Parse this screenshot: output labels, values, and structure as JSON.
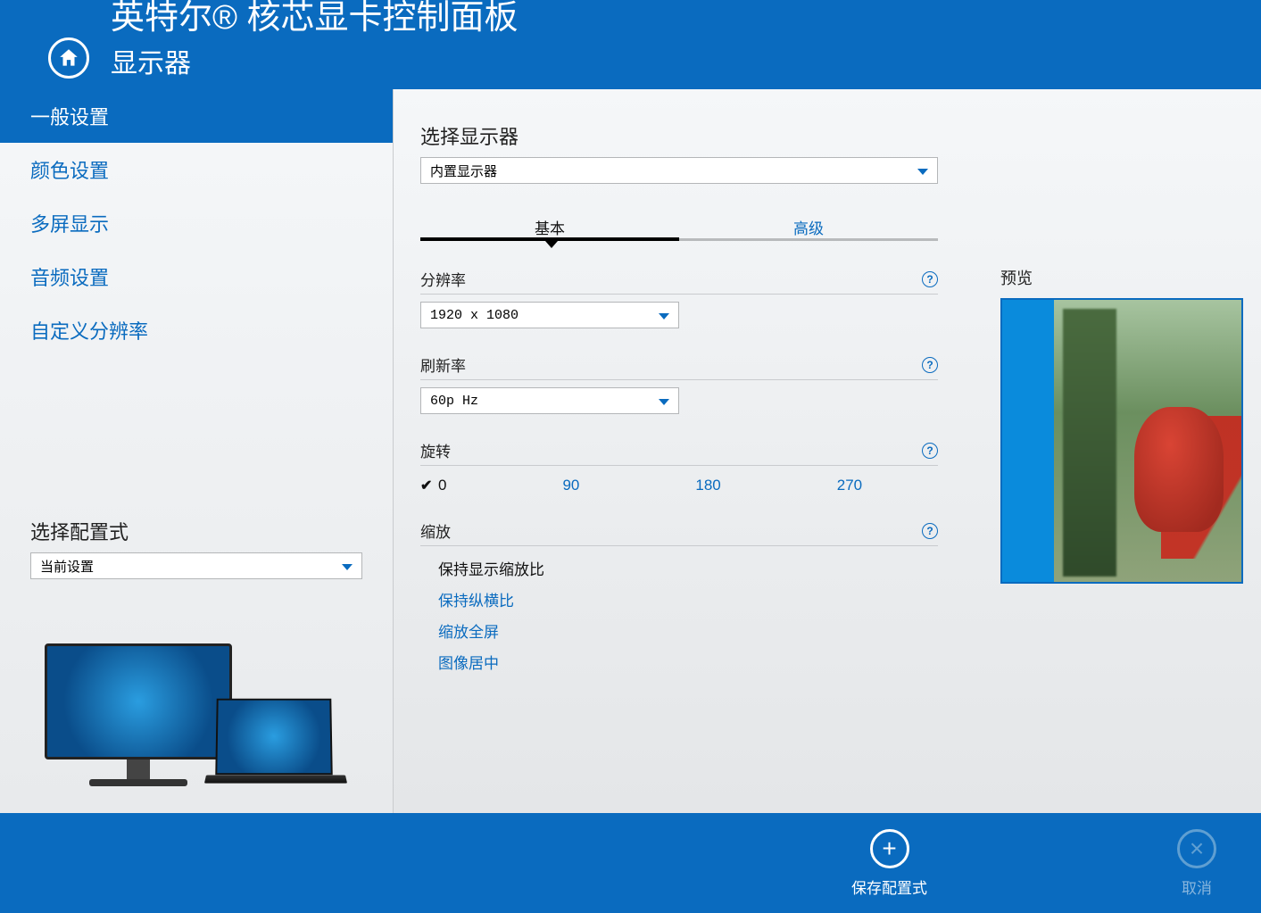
{
  "header": {
    "app_title": "英特尔® 核芯显卡控制面板",
    "page_title": "显示器"
  },
  "sidebar": {
    "items": [
      {
        "label": "一般设置",
        "active": true
      },
      {
        "label": "颜色设置",
        "active": false
      },
      {
        "label": "多屏显示",
        "active": false
      },
      {
        "label": "音频设置",
        "active": false
      },
      {
        "label": "自定义分辨率",
        "active": false
      }
    ],
    "profile_label": "选择配置式",
    "profile_value": "当前设置"
  },
  "main": {
    "select_display_label": "选择显示器",
    "select_display_value": "内置显示器",
    "tabs": {
      "basic": "基本",
      "advanced": "高级"
    },
    "resolution": {
      "label": "分辨率",
      "value": "1920 x 1080"
    },
    "refresh": {
      "label": "刷新率",
      "value": "60p Hz"
    },
    "rotation": {
      "label": "旋转",
      "options": [
        "0",
        "90",
        "180",
        "270"
      ],
      "selected": "0"
    },
    "scaling": {
      "label": "缩放",
      "options": [
        {
          "label": "保持显示缩放比",
          "selected": true
        },
        {
          "label": "保持纵横比",
          "selected": false
        },
        {
          "label": "缩放全屏",
          "selected": false
        },
        {
          "label": "图像居中",
          "selected": false
        }
      ]
    },
    "preview_label": "预览"
  },
  "footer": {
    "save_label": "保存配置式",
    "cancel_label": "取消"
  }
}
